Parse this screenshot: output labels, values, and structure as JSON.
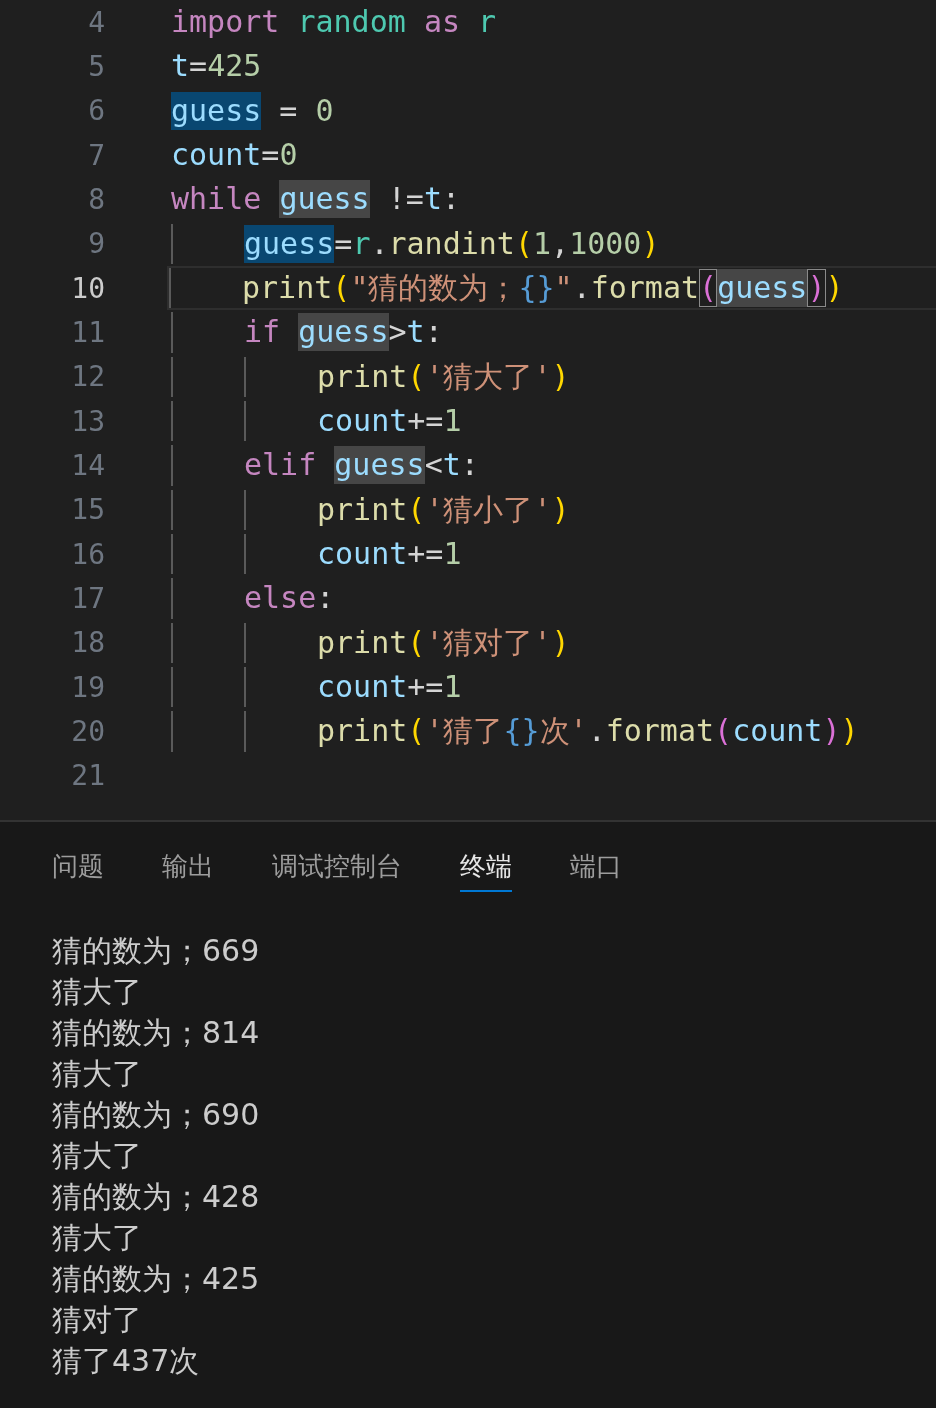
{
  "editor": {
    "lines": [
      {
        "number": "4",
        "current": false,
        "tokens": [
          {
            "kind": "keyword",
            "text": "import"
          },
          {
            "kind": "module",
            "text": " random "
          },
          {
            "kind": "keyword",
            "text": "as"
          },
          {
            "kind": "module",
            "text": " r"
          }
        ]
      },
      {
        "number": "5",
        "current": false,
        "tokens": [
          {
            "kind": "variable",
            "text": "t"
          },
          {
            "kind": "operator",
            "text": "="
          },
          {
            "kind": "number",
            "text": "425"
          }
        ]
      },
      {
        "number": "6",
        "current": false,
        "tokens": [
          {
            "kind": "variable",
            "text": "guess",
            "highlighted": true,
            "write": true
          },
          {
            "kind": "operator",
            "text": " = "
          },
          {
            "kind": "number",
            "text": "0"
          }
        ]
      },
      {
        "number": "7",
        "current": false,
        "tokens": [
          {
            "kind": "variable",
            "text": "count"
          },
          {
            "kind": "operator",
            "text": "="
          },
          {
            "kind": "number",
            "text": "0"
          }
        ]
      },
      {
        "number": "8",
        "current": false,
        "tokens": [
          {
            "kind": "keyword",
            "text": "while "
          },
          {
            "kind": "variable",
            "text": "guess",
            "highlighted": true,
            "write": false
          },
          {
            "kind": "operator",
            "text": " !="
          },
          {
            "kind": "variable",
            "text": "t"
          },
          {
            "kind": "operator",
            "text": ":"
          }
        ],
        "children": [
          {
            "number": "9",
            "current": false,
            "tokens": [
              {
                "kind": "variable",
                "text": "guess",
                "highlighted": true,
                "write": true
              },
              {
                "kind": "operator",
                "text": "="
              },
              {
                "kind": "module",
                "text": "r"
              },
              {
                "kind": "operator",
                "text": "."
              },
              {
                "kind": "function",
                "text": "randint"
              },
              {
                "kind": "bracket1",
                "text": "("
              },
              {
                "kind": "number",
                "text": "1"
              },
              {
                "kind": "operator",
                "text": ","
              },
              {
                "kind": "number",
                "text": "1000"
              },
              {
                "kind": "bracket1",
                "text": ")"
              }
            ]
          },
          {
            "number": "10",
            "current": true,
            "tokens": [
              {
                "kind": "function",
                "text": "print"
              },
              {
                "kind": "bracket1",
                "text": "("
              },
              {
                "kind": "string",
                "text": "\"猜的数为；"
              },
              {
                "kind": "placeholder",
                "text": "{}"
              },
              {
                "kind": "string",
                "text": "\""
              },
              {
                "kind": "operator",
                "text": "."
              },
              {
                "kind": "function",
                "text": "format"
              },
              {
                "kind": "bracket2",
                "text": "(",
                "boxed": true
              },
              {
                "kind": "variable",
                "text": "guess",
                "highlighted": true,
                "write": false
              },
              {
                "kind": "bracket2",
                "text": ")",
                "boxed": true
              },
              {
                "kind": "bracket1",
                "text": ")"
              }
            ]
          },
          {
            "number": "11",
            "current": false,
            "tokens": [
              {
                "kind": "keyword",
                "text": "if "
              },
              {
                "kind": "variable",
                "text": "guess",
                "highlighted": true,
                "write": false
              },
              {
                "kind": "operator",
                "text": ">"
              },
              {
                "kind": "variable",
                "text": "t"
              },
              {
                "kind": "operator",
                "text": ":"
              }
            ],
            "children": [
              {
                "number": "12",
                "current": false,
                "tokens": [
                  {
                    "kind": "function",
                    "text": "print"
                  },
                  {
                    "kind": "bracket1",
                    "text": "("
                  },
                  {
                    "kind": "string",
                    "text": "'猜大了'"
                  },
                  {
                    "kind": "bracket1",
                    "text": ")"
                  }
                ]
              },
              {
                "number": "13",
                "current": false,
                "tokens": [
                  {
                    "kind": "variable",
                    "text": "count"
                  },
                  {
                    "kind": "operator",
                    "text": "+="
                  },
                  {
                    "kind": "number",
                    "text": "1"
                  }
                ]
              }
            ]
          },
          {
            "number": "14",
            "current": false,
            "tokens": [
              {
                "kind": "keyword",
                "text": "elif "
              },
              {
                "kind": "variable",
                "text": "guess",
                "highlighted": true,
                "write": false
              },
              {
                "kind": "operator",
                "text": "<"
              },
              {
                "kind": "variable",
                "text": "t"
              },
              {
                "kind": "operator",
                "text": ":"
              }
            ],
            "children": [
              {
                "number": "15",
                "current": false,
                "tokens": [
                  {
                    "kind": "function",
                    "text": "print"
                  },
                  {
                    "kind": "bracket1",
                    "text": "("
                  },
                  {
                    "kind": "string",
                    "text": "'猜小了'"
                  },
                  {
                    "kind": "bracket1",
                    "text": ")"
                  }
                ]
              },
              {
                "number": "16",
                "current": false,
                "tokens": [
                  {
                    "kind": "variable",
                    "text": "count"
                  },
                  {
                    "kind": "operator",
                    "text": "+="
                  },
                  {
                    "kind": "number",
                    "text": "1"
                  }
                ]
              }
            ]
          },
          {
            "number": "17",
            "current": false,
            "tokens": [
              {
                "kind": "keyword",
                "text": "else"
              },
              {
                "kind": "operator",
                "text": ":"
              }
            ],
            "children": [
              {
                "number": "18",
                "current": false,
                "tokens": [
                  {
                    "kind": "function",
                    "text": "print"
                  },
                  {
                    "kind": "bracket1",
                    "text": "("
                  },
                  {
                    "kind": "string",
                    "text": "'猜对了'"
                  },
                  {
                    "kind": "bracket1",
                    "text": ")"
                  }
                ]
              },
              {
                "number": "19",
                "current": false,
                "tokens": [
                  {
                    "kind": "variable",
                    "text": "count"
                  },
                  {
                    "kind": "operator",
                    "text": "+="
                  },
                  {
                    "kind": "number",
                    "text": "1"
                  }
                ]
              },
              {
                "number": "20",
                "current": false,
                "tokens": [
                  {
                    "kind": "function",
                    "text": "print"
                  },
                  {
                    "kind": "bracket1",
                    "text": "("
                  },
                  {
                    "kind": "string",
                    "text": "'猜了"
                  },
                  {
                    "kind": "placeholder",
                    "text": "{}"
                  },
                  {
                    "kind": "string",
                    "text": "次'"
                  },
                  {
                    "kind": "operator",
                    "text": "."
                  },
                  {
                    "kind": "function",
                    "text": "format"
                  },
                  {
                    "kind": "bracket2",
                    "text": "("
                  },
                  {
                    "kind": "variable",
                    "text": "count"
                  },
                  {
                    "kind": "bracket2",
                    "text": ")"
                  },
                  {
                    "kind": "bracket1",
                    "text": ")"
                  }
                ]
              }
            ]
          }
        ]
      },
      {
        "number": "21",
        "current": false
      }
    ]
  },
  "panel": {
    "tabs": [
      {
        "label": "问题",
        "selected": false
      },
      {
        "label": "输出",
        "selected": false
      },
      {
        "label": "调试控制台",
        "selected": false
      },
      {
        "label": "终端",
        "selected": true
      },
      {
        "label": "端口",
        "selected": false
      }
    ],
    "terminal_output": [
      "猜的数为；669",
      "猜大了",
      "猜的数为；814",
      "猜大了",
      "猜的数为；690",
      "猜大了",
      "猜的数为；428",
      "猜大了",
      "猜的数为；425",
      "猜对了",
      "猜了437次"
    ]
  }
}
